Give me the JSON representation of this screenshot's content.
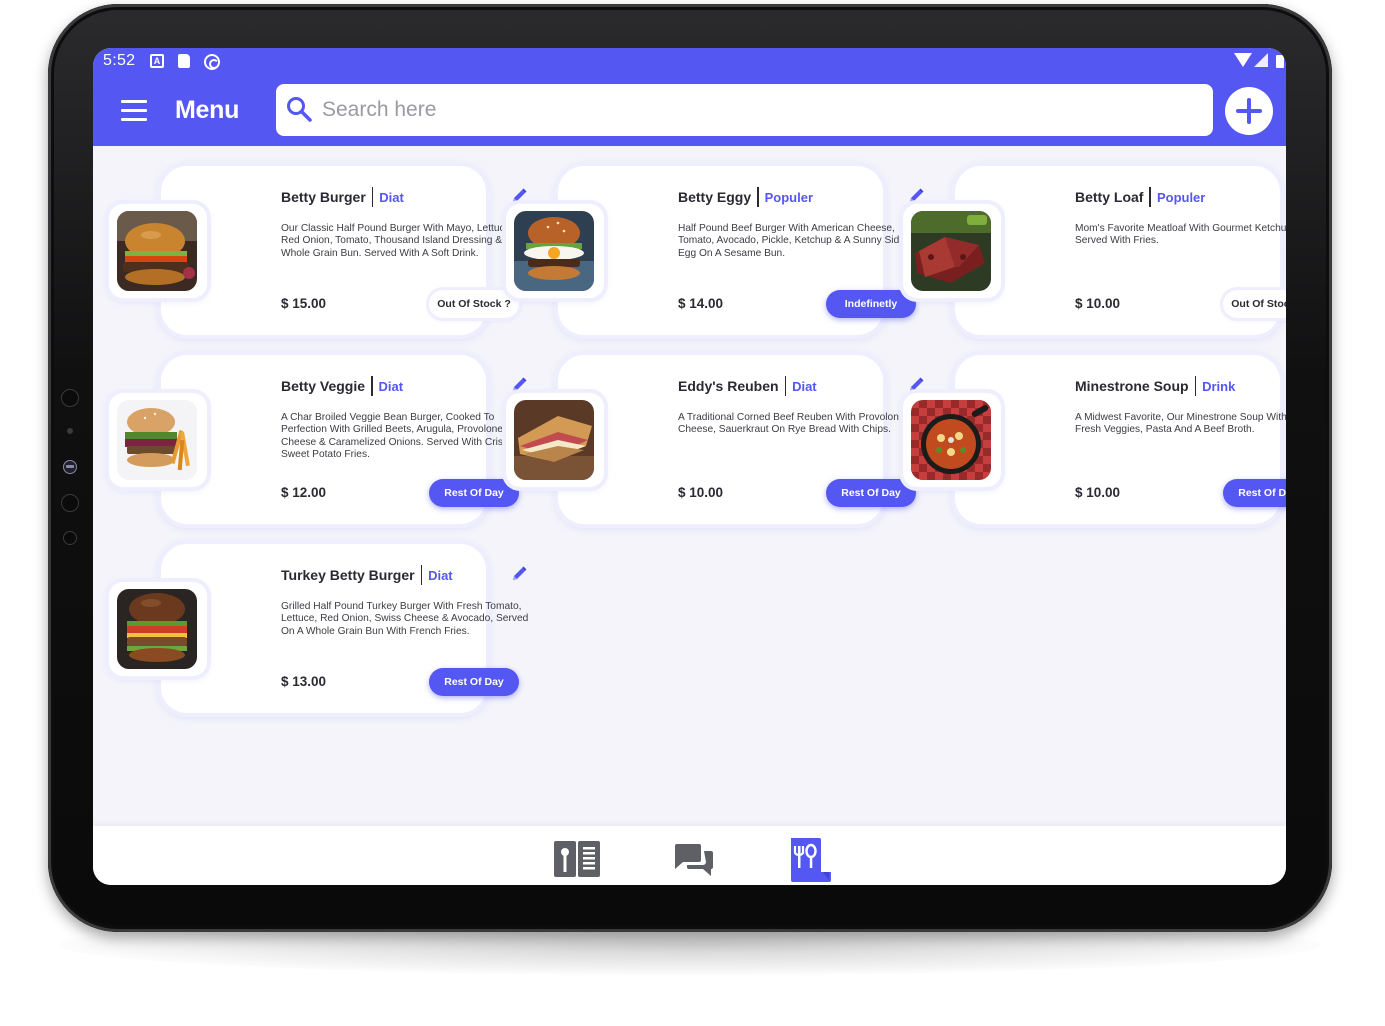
{
  "status": {
    "time": "5:52",
    "a_icon": "A"
  },
  "header": {
    "title": "Menu",
    "search_placeholder": "Search here"
  },
  "colors": {
    "accent": "#5557f2",
    "background": "#f4f4fa",
    "text": "#2a2a33"
  },
  "items": [
    {
      "name": "Betty Burger",
      "tag": "Diat",
      "desc": "Our Classic Half Pound Burger With Mayo, Lettuce, Red Onion, Tomato, Thousand Island Dressing & Whole Grain Bun. Served With A Soft Drink.",
      "price": "$ 15.00",
      "status": "Out Of Stock ?",
      "status_style": "outline",
      "image": "burger"
    },
    {
      "name": "Betty Eggy",
      "tag": "Populer",
      "desc": "Half Pound Beef Burger With American Cheese, Tomato, Avocado, Pickle, Ketchup & A Sunny Side Up Egg On A Sesame Bun.",
      "price": "$ 14.00",
      "status": "Indefinetly",
      "status_style": "filled",
      "image": "egg-burger"
    },
    {
      "name": "Betty Loaf",
      "tag": "Populer",
      "desc": "Mom's Favorite Meatloaf With Gourmet Ketchup And Served With Fries.",
      "price": "$ 10.00",
      "status": "Out Of Stock ?",
      "status_style": "outline",
      "image": "meatloaf"
    },
    {
      "name": "Betty Veggie",
      "tag": "Diat",
      "desc": "A Char Broiled Veggie Bean Burger, Cooked To Perfection With Grilled Beets, Arugula, Provolone Cheese & Caramelized Onions. Served With Crispy Sweet Potato Fries.",
      "price": "$ 12.00",
      "status": "Rest Of Day",
      "status_style": "filled",
      "image": "veggie-burger"
    },
    {
      "name": "Eddy's Reuben",
      "tag": "Diat",
      "desc": "A Traditional Corned Beef Reuben With Provolone Cheese, Sauerkraut On Rye Bread With Chips.",
      "price": "$ 10.00",
      "status": "Rest Of Day",
      "status_style": "filled",
      "image": "reuben"
    },
    {
      "name": "Minestrone Soup",
      "tag": "Drink",
      "desc": "A Midwest Favorite, Our Minestrone Soup With Beans, Fresh Veggies, Pasta And A Beef Broth.",
      "price": "$ 10.00",
      "status": "Rest Of Day",
      "status_style": "filled",
      "image": "soup"
    },
    {
      "name": "Turkey Betty Burger",
      "tag": "Diat",
      "desc": "Grilled Half Pound Turkey Burger With Fresh Tomato, Lettuce, Red Onion, Swiss Cheese & Avocado, Served On A Whole Grain Bun With French Fries.",
      "price": "$ 13.00",
      "status": "Rest Of Day",
      "status_style": "filled",
      "image": "turkey-burger"
    }
  ],
  "bottom_nav": [
    {
      "icon": "menu-book-icon",
      "active": false
    },
    {
      "icon": "chat-icon",
      "active": false
    },
    {
      "icon": "restaurant-menu-icon",
      "active": true
    }
  ]
}
